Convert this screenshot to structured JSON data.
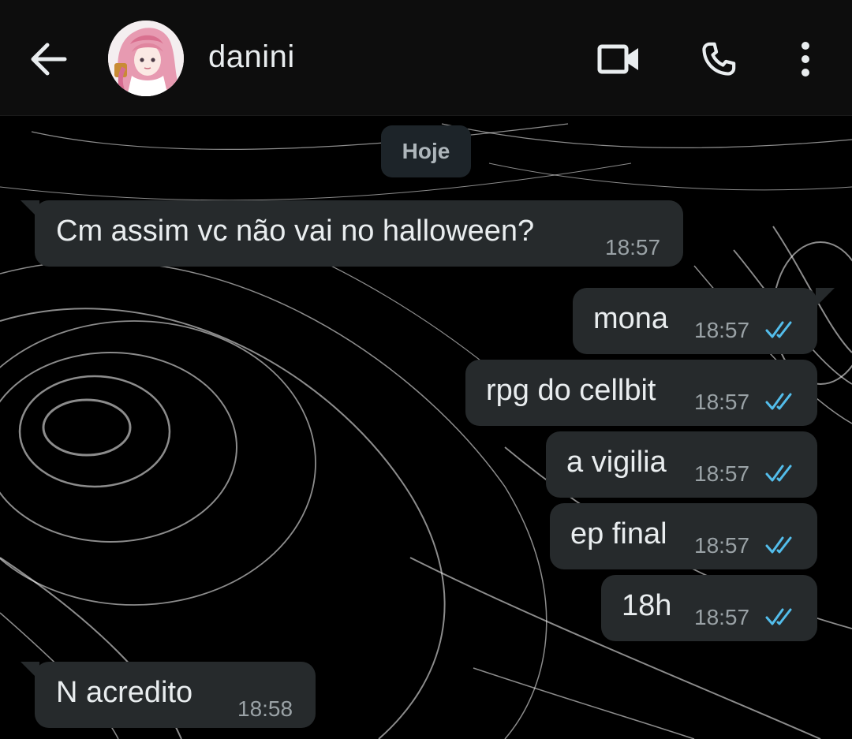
{
  "header": {
    "contact_name": "danini",
    "icons": {
      "back": "arrow-left-icon",
      "video": "video-camera-icon",
      "call": "phone-icon",
      "menu": "more-vertical-icon"
    }
  },
  "chat": {
    "date_label": "Hoje",
    "messages": [
      {
        "direction": "incoming",
        "text": "Cm assim vc não vai no halloween?",
        "time": "18:57"
      },
      {
        "direction": "outgoing",
        "text": "mona",
        "time": "18:57",
        "status": "read"
      },
      {
        "direction": "outgoing",
        "text": "rpg do cellbit",
        "time": "18:57",
        "status": "read"
      },
      {
        "direction": "outgoing",
        "text": "a vigilia",
        "time": "18:57",
        "status": "read"
      },
      {
        "direction": "outgoing",
        "text": "ep final",
        "time": "18:57",
        "status": "read"
      },
      {
        "direction": "outgoing",
        "text": "18h",
        "time": "18:57",
        "status": "read"
      },
      {
        "direction": "incoming",
        "text": "N acredito",
        "time": "18:58"
      }
    ]
  },
  "colors": {
    "header_bg": "#0d0d0d",
    "bubble_bg": "#262a2c",
    "read_ticks": "#53bdeb",
    "text": "#e9edef",
    "timestamp": "#9aa2a6"
  }
}
